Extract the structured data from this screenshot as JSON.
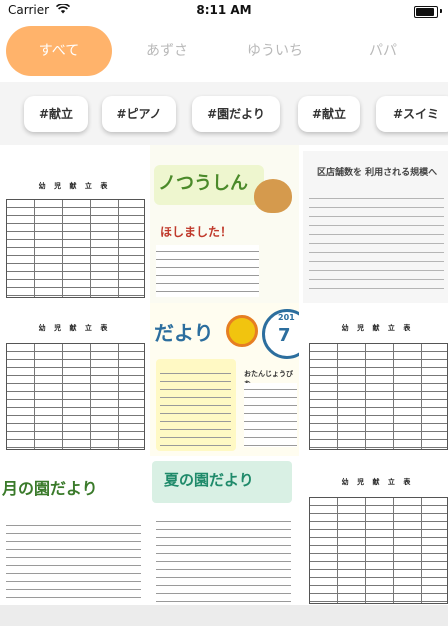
{
  "status_bar": {
    "carrier": "Carrier",
    "time": "8:11 AM"
  },
  "tabs": [
    {
      "label": "すべて",
      "active": true
    },
    {
      "label": "あずさ",
      "active": false
    },
    {
      "label": "ゆういち",
      "active": false
    },
    {
      "label": "パパ",
      "active": false
    }
  ],
  "tags": [
    {
      "label": "#献立"
    },
    {
      "label": "#ピアノ"
    },
    {
      "label": "#園だより"
    },
    {
      "label": "#献立"
    },
    {
      "label": "#スイミ"
    }
  ],
  "thumbnails": [
    {
      "kind": "menu-table",
      "title": "幼 児 献 立 表"
    },
    {
      "kind": "piano-newsletter",
      "headline": "ノつうしん",
      "subline": "ほしました！"
    },
    {
      "kind": "text-notice",
      "headline": "区店舗数を 利用される規模へ"
    },
    {
      "kind": "menu-table",
      "title": "幼 児 献 立 表"
    },
    {
      "kind": "school-newsletter",
      "headline": "だより",
      "badge_top": "201",
      "badge_num": "7",
      "side_text": "おたんじょうびを"
    },
    {
      "kind": "menu-table",
      "title": "幼 児 献 立 表"
    },
    {
      "kind": "school-newsletter-2",
      "headline": "月の園だより"
    },
    {
      "kind": "summer-newsletter",
      "headline": "夏の園だより"
    },
    {
      "kind": "menu-table",
      "title": "幼 児 献 立 表"
    }
  ],
  "colors": {
    "accent": "#ffb36b",
    "inactive_tab": "#b9b9b9"
  }
}
